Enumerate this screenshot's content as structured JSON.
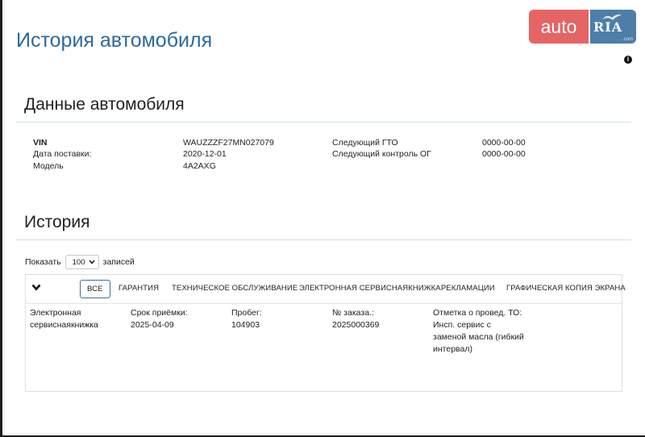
{
  "page": {
    "title": "История автомобиля"
  },
  "logo": {
    "left": "auto",
    "right": "RIA",
    "sub": ".com"
  },
  "car_data": {
    "title": "Данные автомобиля",
    "rows_left": [
      {
        "label": "VIN",
        "value": "WAUZZZF27MN027079"
      },
      {
        "label": "Дата поставки:",
        "value": "2020-12-01"
      },
      {
        "label": "Модель",
        "value": "4A2AXG"
      }
    ],
    "rows_right": [
      {
        "label": "Следующий ГТО",
        "value": "0000-00-00"
      },
      {
        "label": "Следующий контроль ОГ",
        "value": "0000-00-00"
      }
    ]
  },
  "history": {
    "title": "История",
    "show_label": "Показать",
    "page_size": "100",
    "records_label": "записей",
    "tabs": [
      "ВСЕ",
      "ГАРАНТИЯ",
      "ТЕХНИЧЕСКОЕ ОБСЛУЖИВАНИЕ",
      "ЭЛЕКТРОННАЯ СЕРВИСНАЯКНИЖКА",
      "РЕКЛАМАЦИИ",
      "ГРАФИЧЕСКАЯ КОПИЯ ЭКРАНА"
    ],
    "entry": {
      "type": "Электронная сервиснаякнижка",
      "date_label": "Срок приёмки:",
      "date": "2025-04-09",
      "mileage_label": "Пробег:",
      "mileage": "104903",
      "order_label": "№ заказа.:",
      "order": "2025000369",
      "note_label": "Отметка о провед. ТО:",
      "note": "Инсп. сервис с заменой масла (гибкий интервал)"
    }
  }
}
